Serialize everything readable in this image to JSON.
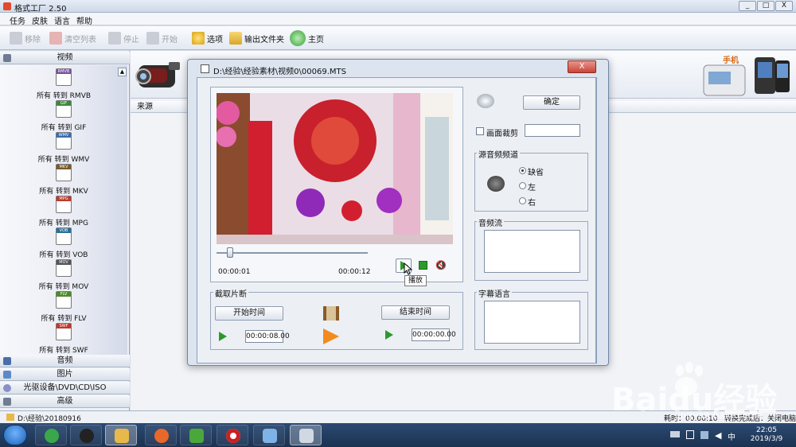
{
  "app": {
    "title": "格式工厂  2.50",
    "window_buttons": [
      "_",
      "□",
      "X"
    ]
  },
  "menu": [
    "任务",
    "皮肤",
    "语言",
    "帮助"
  ],
  "toolbar": {
    "remove": "移除",
    "clear_list": "清空列表",
    "stop": "停止",
    "start": "开始",
    "options": "选项",
    "output_folder": "输出文件夹",
    "home": "主页"
  },
  "left_panel": {
    "video_category": "视频",
    "items": [
      {
        "tag": "RMVB",
        "label": "所有 转到 RMVB",
        "color": "#7a4fa1"
      },
      {
        "tag": "GIF",
        "label": "所有 转到 GIF",
        "color": "#3d8a3d"
      },
      {
        "tag": "WMV",
        "label": "所有 转到 WMV",
        "color": "#3a6db0"
      },
      {
        "tag": "MKV",
        "label": "所有 转到 MKV",
        "color": "#7a5a2b"
      },
      {
        "tag": "MPG",
        "label": "所有 转到 MPG",
        "color": "#c0392b"
      },
      {
        "tag": "VOB",
        "label": "所有 转到 VOB",
        "color": "#2b6f9a"
      },
      {
        "tag": "MOV",
        "label": "所有 转到 MOV",
        "color": "#555555"
      },
      {
        "tag": "FLV",
        "label": "所有 转到 FLV",
        "color": "#4f8a2b"
      },
      {
        "tag": "SWF",
        "label": "所有 转到 SWF",
        "color": "#c0392b"
      }
    ],
    "categories_bottom": [
      "音频",
      "图片",
      "光驱设备\\DVD\\CD\\ISO",
      "高级"
    ]
  },
  "main": {
    "source_header": "来源",
    "phone_label": "手机"
  },
  "status_bar": {
    "path": "D:\\经验\\20180916",
    "elapsed": "耗时：00:00:10",
    "after_convert": "转换完成后：关闭电脑"
  },
  "dialog": {
    "title": "D:\\经验\\经验素材\\视频0\\00069.MTS",
    "close": "X",
    "time_start": "00:00:01",
    "time_end": "00:00:12",
    "slider_position": 0.08,
    "tooltip": "播放",
    "clip_group": "截取片断",
    "start_time_btn": "开始时间",
    "end_time_btn": "结束时间",
    "start_time_value": "00:00:08.00",
    "end_time_value": "00:00:00.00",
    "ok": "确定",
    "crop_label": "画面裁剪",
    "crop_checked": false,
    "audio_channel_group": "源音频频道",
    "channels": [
      {
        "label": "缺省",
        "selected": true
      },
      {
        "label": "左",
        "selected": false
      },
      {
        "label": "右",
        "selected": false
      }
    ],
    "audio_stream_group": "音频流",
    "subtitle_group": "字幕语言"
  },
  "taskbar": {
    "time": "22:05",
    "date": "2019/3/9",
    "apps": [
      {
        "icon": "browser-360-icon",
        "color": "#3aa84a"
      },
      {
        "icon": "qq-icon",
        "color": "#222222"
      },
      {
        "icon": "file-explorer-icon",
        "color": "#e7b94a"
      },
      {
        "icon": "firefox-icon",
        "color": "#e8682a"
      },
      {
        "icon": "video-player-icon",
        "color": "#4aa83a"
      },
      {
        "icon": "record-icon",
        "color": "#cc1f1f"
      },
      {
        "icon": "ebook-icon",
        "color": "#7fb3e8"
      },
      {
        "icon": "format-factory-icon",
        "color": "#cfd8e3"
      }
    ]
  },
  "watermark": {
    "logo": "Baidu经验",
    "url": "jingyan.baidu.com"
  }
}
